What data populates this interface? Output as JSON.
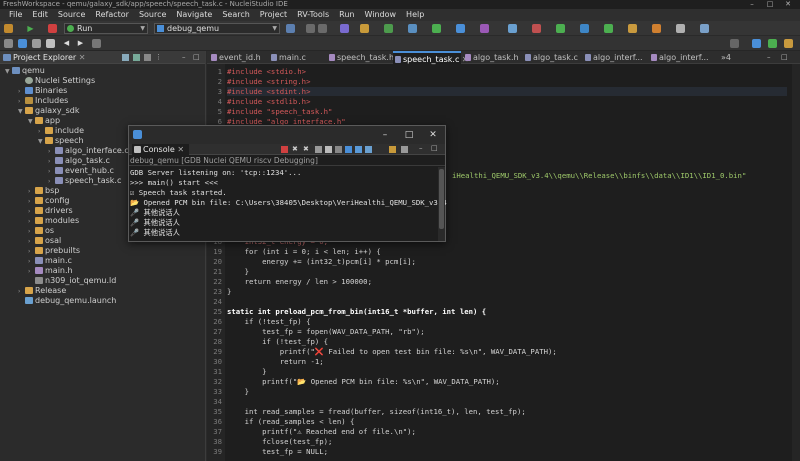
{
  "window": {
    "title": "FreshWorkspace - qemu/galaxy_sdk/app/speech/speech_task.c - NucleiStudio IDE"
  },
  "menu": [
    "File",
    "Edit",
    "Source",
    "Refactor",
    "Source",
    "Navigate",
    "Search",
    "Project",
    "RV-Tools",
    "Run",
    "Window",
    "Help"
  ],
  "toolbar": {
    "run_mode": "Run",
    "launch_config": "debug_qemu"
  },
  "explorer": {
    "title": "Project Explorer",
    "tree": [
      {
        "label": "qemu",
        "icon": "project-icon"
      },
      {
        "label": "Nuclei Settings",
        "icon": "settings-icon"
      },
      {
        "label": "Binaries",
        "icon": "binaries-icon"
      },
      {
        "label": "Includes",
        "icon": "includes-icon"
      },
      {
        "label": "galaxy_sdk",
        "icon": "folder-icon"
      },
      {
        "label": "app",
        "icon": "folder-icon"
      },
      {
        "label": "include",
        "icon": "folder-icon"
      },
      {
        "label": "speech",
        "icon": "folder-icon"
      },
      {
        "label": "algo_interface.c",
        "icon": "c-file-icon"
      },
      {
        "label": "algo_task.c",
        "icon": "c-file-icon"
      },
      {
        "label": "event_hub.c",
        "icon": "c-file-icon"
      },
      {
        "label": "speech_task.c",
        "icon": "c-file-icon"
      },
      {
        "label": "bsp",
        "icon": "folder-icon"
      },
      {
        "label": "config",
        "icon": "folder-icon"
      },
      {
        "label": "drivers",
        "icon": "folder-icon"
      },
      {
        "label": "modules",
        "icon": "folder-icon"
      },
      {
        "label": "os",
        "icon": "folder-icon"
      },
      {
        "label": "osal",
        "icon": "folder-icon"
      },
      {
        "label": "prebuilts",
        "icon": "folder-icon"
      },
      {
        "label": "main.c",
        "icon": "c-file-icon"
      },
      {
        "label": "main.h",
        "icon": "h-file-icon"
      },
      {
        "label": "n309_iot_qemu.ld",
        "icon": "ld-file-icon"
      },
      {
        "label": "Release",
        "icon": "folder-icon"
      },
      {
        "label": "debug_qemu.launch",
        "icon": "launch-file-icon"
      }
    ]
  },
  "editor": {
    "tabs": [
      "event_id.h",
      "main.c",
      "speech_task.h",
      "speech_task.c",
      "algo_task.h",
      "algo_task.c",
      "algo_interf...",
      "algo_interf..."
    ],
    "tab_overflow": "»4",
    "active_tab": "speech_task.c",
    "line_numbers": [
      "1",
      "2",
      "3",
      "4",
      "5",
      "6",
      "7",
      "",
      "",
      "",
      "",
      "",
      "",
      "",
      "",
      "",
      "",
      "18",
      "19",
      "20",
      "21",
      "22",
      "23",
      "24",
      "25",
      "26",
      "27",
      "28",
      "29",
      "30",
      "31",
      "32",
      "33",
      "34",
      "35",
      "36",
      "37",
      "38",
      "39",
      "40"
    ],
    "code": {
      "l1": "#include <stdio.h>",
      "l2": "#include <string.h>",
      "l3": "#include <stdint.h>",
      "l4": "#include <stdlib.h>",
      "l5": "#include \"speech_task.h\"",
      "l6": "#include \"algo_interface.h\"",
      "path_tail": "iHealthi_QEMU_SDK_v3.4\\\\qemu\\\\Release\\\\binfs\\\\data\\\\ID1\\\\ID1_0.bin\"",
      "l18": "    int32_t energy = 0;",
      "l19": "    for (int i = 0; i < len; i++) {",
      "l20": "        energy += (int32_t)pcm[i] * pcm[i];",
      "l21": "    }",
      "l22": "    return energy / len > 100000;",
      "l23": "}",
      "l25": "static int preload_pcm_from_bin(int16_t *buffer, int len) {",
      "l26": "    if (!test_fp) {",
      "l27": "        test_fp = fopen(WAV_DATA_PATH, \"rb\");",
      "l28": "        if (!test_fp) {",
      "l29": "            printf(\"❌ Failed to open test bin file: %s\\n\", WAV_DATA_PATH);",
      "l30": "            return -1;",
      "l31": "        }",
      "l32": "        printf(\"📂 Opened PCM bin file: %s\\n\", WAV_DATA_PATH);",
      "l33": "    }",
      "l35": "    int read_samples = fread(buffer, sizeof(int16_t), len, test_fp);",
      "l36": "    if (read_samples < len) {",
      "l37": "        printf(\"⚠ Reached end of file.\\n\");",
      "l38": "        fclose(test_fp);",
      "l39": "        test_fp = NULL;"
    }
  },
  "console": {
    "tab_label": "Console",
    "subtitle": "debug_qemu [GDB Nuclei QEMU riscv Debugging]",
    "lines": [
      "GDB Server listening on: 'tcp::1234'...",
      ">>> main() start <<<",
      "☑ Speech task started.",
      "📂 Opened PCM bin file: C:\\Users\\38405\\Desktop\\VeriHealthi_QEMU_SDK_v3.4",
      "🎤 其他说话人",
      "🎤 其他说话人",
      "🎤 其他说话人"
    ]
  },
  "colors": {
    "accent": "#4a8fd8",
    "keyword": "#d4595a",
    "string": "#9ec96a",
    "editor_bg": "#1e1e1e"
  }
}
